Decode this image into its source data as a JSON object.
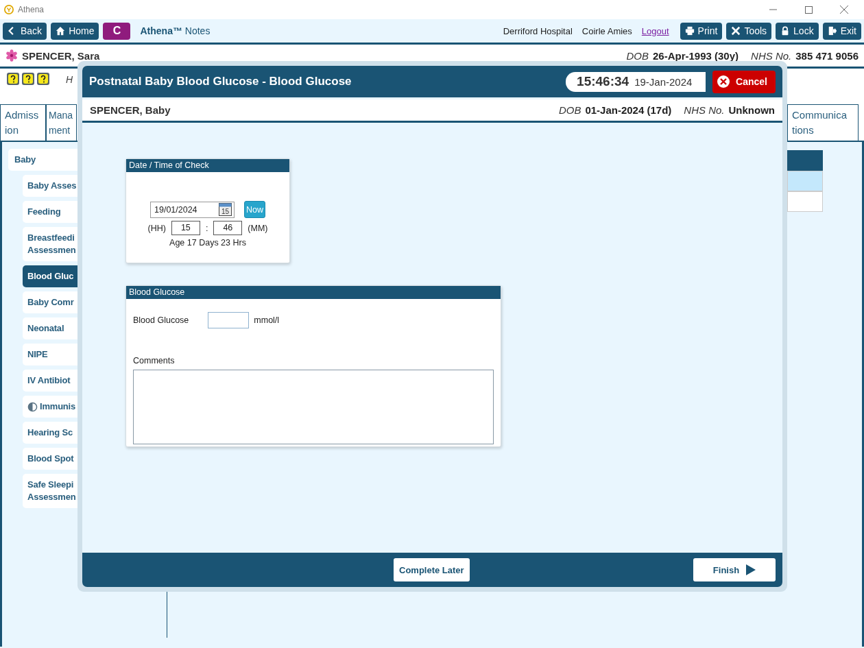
{
  "window": {
    "title": "Athena"
  },
  "toolbar": {
    "left_buttons": [
      {
        "label": "Back"
      },
      {
        "label": "Home"
      }
    ],
    "badge": "C",
    "app_name": "Athena™",
    "app_subtitle": "Notes",
    "hospital": "Derriford Hospital",
    "user": "Coirle Amies",
    "logout": "Logout",
    "right_buttons": [
      {
        "label": "Print"
      },
      {
        "label": "Tools"
      },
      {
        "label": "Lock"
      },
      {
        "label": "Exit"
      }
    ]
  },
  "patient": {
    "name": "SPENCER, Sara",
    "dob_label": "DOB",
    "dob": "26-Apr-1993 (30y)",
    "nhs_label": "NHS No.",
    "nhs": "385 471 9056"
  },
  "alerts": {
    "text": "H"
  },
  "tabs": [
    {
      "label": "Admiss ion"
    },
    {
      "label": "Mana ment"
    },
    {
      "label": "Communica tions"
    }
  ],
  "sidebar": {
    "group": "Baby",
    "items": [
      {
        "label": "Baby Asses",
        "selected": false,
        "kind": "plain"
      },
      {
        "label": "Feeding",
        "selected": false,
        "kind": "plain"
      },
      {
        "label": "Breastfeedi Assessmen",
        "selected": false,
        "kind": "plain"
      },
      {
        "label": "Blood Gluc",
        "selected": true,
        "kind": "plain"
      },
      {
        "label": "Baby Comr",
        "selected": false,
        "kind": "plain"
      },
      {
        "label": "Neonatal",
        "selected": false,
        "kind": "plain"
      },
      {
        "label": "NIPE",
        "selected": false,
        "kind": "plain"
      },
      {
        "label": "IV Antibiot",
        "selected": false,
        "kind": "plain"
      },
      {
        "label": "Immunis",
        "selected": false,
        "kind": "status"
      },
      {
        "label": "Hearing Sc",
        "selected": false,
        "kind": "plain"
      },
      {
        "label": "Blood Spot",
        "selected": false,
        "kind": "plain"
      },
      {
        "label": "Safe Sleepi Assessmen",
        "selected": false,
        "kind": "plain"
      }
    ]
  },
  "side_table": {
    "rows": [
      {
        "selected": true
      },
      {
        "selected": false
      }
    ]
  },
  "modal": {
    "title": "Postnatal Baby Blood Glucose - Blood Glucose",
    "time": "15:46:34",
    "date": "19-Jan-2024",
    "cancel": "Cancel",
    "patient": {
      "name": "SPENCER, Baby",
      "dob_label": "DOB",
      "dob": "01-Jan-2024 (17d)",
      "nhs_label": "NHS No.",
      "nhs": "Unknown"
    },
    "date_panel": {
      "title": "Date / Time of Check",
      "date": "19/01/2024",
      "calendar_day": "15",
      "now": "Now",
      "hh_label": "(HH)",
      "hh": "15",
      "separator": ":",
      "mm": "46",
      "mm_label": "(MM)",
      "age": "Age 17 Days 23 Hrs"
    },
    "glucose_panel": {
      "title": "Blood Glucose",
      "label": "Blood Glucose",
      "unit": "mmol/l",
      "comments_label": "Comments"
    },
    "footer": {
      "complete_later": "Complete Later",
      "finish": "Finish"
    }
  }
}
